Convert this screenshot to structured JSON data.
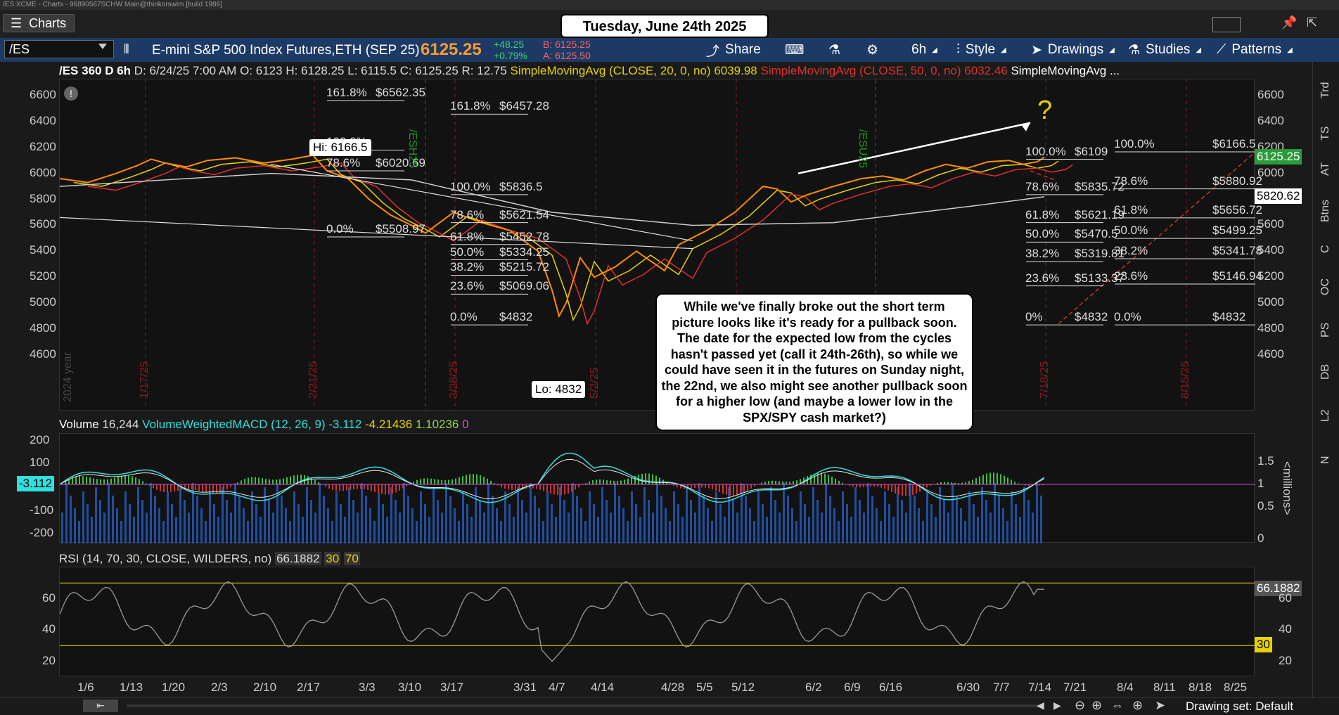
{
  "window_title": "/ES:XCME - Charts - 96890567SCHW Main@thinkorswim [build 1986]",
  "tab": {
    "label": "Charts"
  },
  "date_box": "Tuesday, June 24th 2025",
  "toolbar": {
    "symbol": "/ES",
    "description": "E-mini S&P 500 Index Futures,ETH (SEP 25)",
    "last_price": "6125.25",
    "change": "+48.25",
    "change_pct": "+0.79%",
    "bid": "B: 6125.25",
    "ask": "A: 6125.50",
    "share": "Share",
    "timeframe": "6h",
    "style": "Style",
    "drawings": "Drawings",
    "studies": "Studies",
    "patterns": "Patterns"
  },
  "chart_header": {
    "symbol_tf": "/ES 360 D 6h",
    "date": "D: 6/24/25 7:00 AM",
    "open": "O: 6123",
    "high": "H: 6128.25",
    "low": "L: 6115.5",
    "close": "C: 6125.25",
    "range": "R: 12.75",
    "sma20": "SimpleMovingAvg (CLOSE, 20, 0, no)",
    "sma20_val": "6039.98",
    "sma50": "SimpleMovingAvg (CLOSE, 50, 0, no)",
    "sma50_val": "6032.46",
    "sma_more": "SimpleMovingAvg ..."
  },
  "price_axis": [
    "6600",
    "6400",
    "6200",
    "6000",
    "5800",
    "5600",
    "5400",
    "5200",
    "5000",
    "4800",
    "4600"
  ],
  "price_tags": {
    "last": "6125.25",
    "sma": "5820.62"
  },
  "callouts": {
    "hi": "Hi: 6166.5",
    "lo": "Lo: 4832"
  },
  "fib_sets": [
    {
      "labels": [
        "161.8%",
        "100.0%",
        "78.6%",
        "0.0%"
      ],
      "values": [
        "$6562.35",
        "",
        "$6020.69",
        "$5508.97"
      ]
    },
    {
      "labels": [
        "161.8%",
        "100.0%",
        "78.6%",
        "61.8%",
        "50.0%",
        "38.2%",
        "23.6%",
        "0.0%"
      ],
      "values": [
        "$6457.28",
        "$5836.5",
        "$5621.54",
        "$5452.78",
        "$5334.25",
        "$5215.72",
        "$5069.06",
        "$4832"
      ]
    },
    {
      "labels": [
        "100.0%",
        "78.6%",
        "61.8%",
        "50.0%",
        "38.2%",
        "23.6%",
        "0%"
      ],
      "values": [
        "$6109",
        "$5835.72",
        "$5621.19",
        "$5470.5",
        "$5319.81",
        "$5133.37",
        "$4832"
      ]
    },
    {
      "labels": [
        "100.0%",
        "78.6%",
        "61.8%",
        "50.0%",
        "38.2%",
        "23.6%",
        "0.0%"
      ],
      "values": [
        "$6166.5",
        "$5880.92",
        "$5656.72",
        "$5499.25",
        "$5341.78",
        "$5146.94",
        "$4832"
      ]
    }
  ],
  "cycle_dates": [
    "1/17/25",
    "2/21/25",
    "3/28/25",
    "5/2/25",
    "6/6/25",
    "7/18/25",
    "8/15/25"
  ],
  "contract_labels": [
    "/ESH25",
    "/ESU25"
  ],
  "year_label": "2024 year",
  "annotation": "While we've finally broke out the short term picture looks like it's ready for a pullback soon. The date for the expected low from the cycles hasn't passed yet (call it 24th-26th), so while we could have seen it in the futures on Sunday night, the 22nd, we also might see another pullback soon for a higher low (and maybe a lower low in the SPX/SPY cash market?)",
  "volume_header": {
    "label": "Volume",
    "value": "16,244",
    "study": "VolumeWeightedMACD (12, 26, 9)",
    "v1": "-3.112",
    "v2": "-4.21436",
    "v3": "1.10236",
    "v4": "0"
  },
  "volume_axis_left": [
    "200",
    "100",
    "-100",
    "-200"
  ],
  "volume_axis_right": [
    "1.5",
    "1",
    "0.5",
    "0"
  ],
  "volume_units": "<millions>",
  "macd_tag": "-3.112",
  "rsi_header": {
    "study": "RSI (14, 70, 30, CLOSE, WILDERS, no)",
    "value": "66.1882",
    "os": "30",
    "ob": "70"
  },
  "rsi_axis": [
    "60",
    "40",
    "20"
  ],
  "rsi_tags": {
    "value": "66.1882",
    "os": "30"
  },
  "time_axis": [
    "1/6",
    "1/13",
    "1/20",
    "2/3",
    "2/10",
    "2/17",
    "3/3",
    "3/10",
    "3/17",
    "3/31",
    "4/7",
    "4/14",
    "4/28",
    "5/5",
    "5/12",
    "6/2",
    "6/9",
    "6/16",
    "6/30",
    "7/7",
    "7/14",
    "7/21",
    "8/4",
    "8/11",
    "8/18",
    "8/25"
  ],
  "side_tabs": [
    "Trd",
    "TS",
    "AT",
    "Btns",
    "C",
    "OC",
    "PS",
    "DB",
    "L2",
    "N"
  ],
  "bottom": {
    "drawing_set": "Drawing set: Default"
  },
  "colors": {
    "toolbar": "#1d3a66",
    "price_up": "#ff8c00",
    "sma20": "#e6d200",
    "sma50": "#e03030",
    "sma200": "#cccccc",
    "rsi": "#9a9a9a",
    "annotation_bg": "#ffffff"
  }
}
